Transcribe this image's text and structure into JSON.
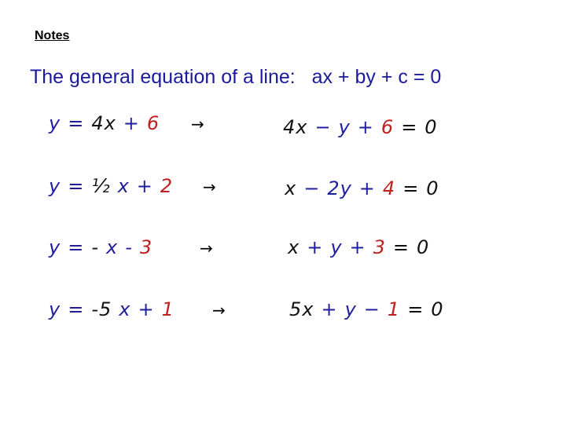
{
  "notes_label": "Notes",
  "headline": "The general equation of a line:   ax + by + c = 0",
  "colors": {
    "variable": "#1f1f9e",
    "number": "#111111",
    "constant": "#c0201f",
    "headline": "#1a1a9c"
  },
  "arrow_symbol": "→",
  "rows": [
    {
      "left": [
        {
          "t": "y",
          "c": "blue"
        },
        {
          "t": "=",
          "c": "blue"
        },
        {
          "t": "4x",
          "c": "black"
        },
        {
          "t": "+",
          "c": "blue"
        },
        {
          "t": "6",
          "c": "red"
        }
      ],
      "right": [
        {
          "t": "4x",
          "c": "black"
        },
        {
          "t": "−",
          "c": "blue"
        },
        {
          "t": "y",
          "c": "blue"
        },
        {
          "t": "+",
          "c": "blue"
        },
        {
          "t": "6",
          "c": "red"
        },
        {
          "t": "=",
          "c": "black"
        },
        {
          "t": "0",
          "c": "black"
        }
      ]
    },
    {
      "left": [
        {
          "t": "y",
          "c": "blue"
        },
        {
          "t": "=",
          "c": "blue"
        },
        {
          "t": "½",
          "c": "black"
        },
        {
          "t": "x",
          "c": "blue"
        },
        {
          "t": "+",
          "c": "blue"
        },
        {
          "t": "2",
          "c": "red"
        }
      ],
      "right": [
        {
          "t": "x",
          "c": "black"
        },
        {
          "t": "−",
          "c": "blue"
        },
        {
          "t": "2y",
          "c": "blue"
        },
        {
          "t": "+",
          "c": "blue"
        },
        {
          "t": "4",
          "c": "red"
        },
        {
          "t": "=",
          "c": "black"
        },
        {
          "t": "0",
          "c": "black"
        }
      ]
    },
    {
      "left": [
        {
          "t": "y",
          "c": "blue"
        },
        {
          "t": "=",
          "c": "blue"
        },
        {
          "t": "-",
          "c": "black"
        },
        {
          "t": "x",
          "c": "blue"
        },
        {
          "t": "-",
          "c": "blue"
        },
        {
          "t": "3",
          "c": "red"
        }
      ],
      "right": [
        {
          "t": "x",
          "c": "black"
        },
        {
          "t": "+",
          "c": "blue"
        },
        {
          "t": "y",
          "c": "blue"
        },
        {
          "t": "+",
          "c": "blue"
        },
        {
          "t": "3",
          "c": "red"
        },
        {
          "t": "=",
          "c": "black"
        },
        {
          "t": "0",
          "c": "black"
        }
      ]
    },
    {
      "left": [
        {
          "t": "y",
          "c": "blue"
        },
        {
          "t": "=",
          "c": "blue"
        },
        {
          "t": "-5",
          "c": "black"
        },
        {
          "t": "x",
          "c": "blue"
        },
        {
          "t": "+",
          "c": "blue"
        },
        {
          "t": "1",
          "c": "red"
        }
      ],
      "right": [
        {
          "t": "5x",
          "c": "black"
        },
        {
          "t": "+",
          "c": "blue"
        },
        {
          "t": "y",
          "c": "blue"
        },
        {
          "t": "−",
          "c": "blue"
        },
        {
          "t": "1",
          "c": "red"
        },
        {
          "t": "=",
          "c": "black"
        },
        {
          "t": "0",
          "c": "black"
        }
      ]
    }
  ]
}
